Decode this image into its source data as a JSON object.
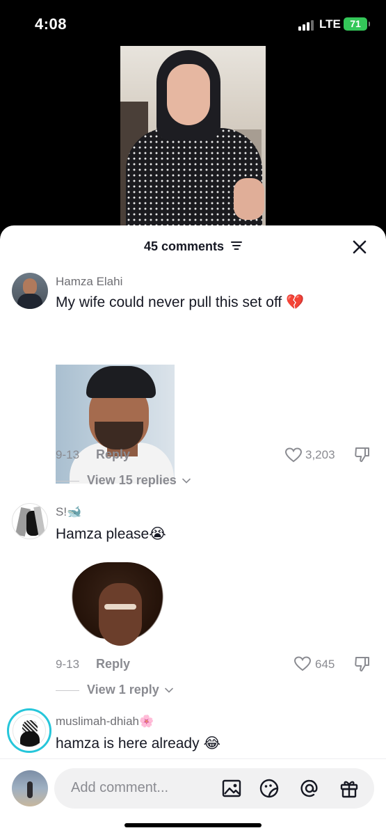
{
  "status_bar": {
    "time": "4:08",
    "network": "LTE",
    "battery": "71"
  },
  "comments_panel": {
    "title": "45 comments",
    "input_placeholder": "Add comment..."
  },
  "comments": [
    {
      "username": "Hamza Elahi",
      "text": "My wife could never pull this set off 💔",
      "date": "9-13",
      "reply_label": "Reply",
      "likes": "3,203",
      "view_replies": "View 15 replies"
    },
    {
      "username": "S!🐋",
      "text": "Hamza please😭",
      "date": "9-13",
      "reply_label": "Reply",
      "likes": "645",
      "view_replies": "View 1 reply"
    },
    {
      "username": "muslimah-dhiah🌸",
      "text": "hamza is here already 😂"
    }
  ],
  "colors": {
    "battery": "#34c759",
    "text": "#161823",
    "muted": "#8a8b91",
    "story_ring": "#26c6da"
  }
}
